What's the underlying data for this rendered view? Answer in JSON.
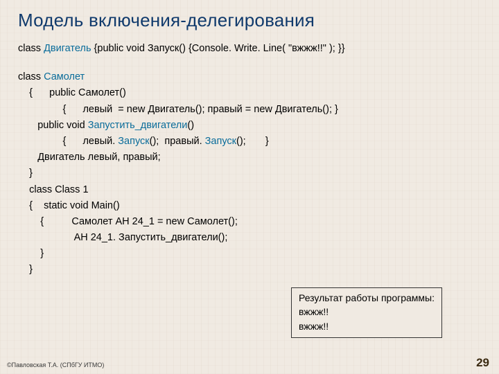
{
  "title": "Модель включения-делегирования",
  "line1": {
    "a": "class ",
    "b": "Двигатель ",
    "c": "{public void Запуск() {Console. Write. Line( \"вжжж!!\" ); }}"
  },
  "code": {
    "l1a": "class ",
    "l1b": "Самолет",
    "l2": "    {      public Самолет()",
    "l3": "                {      левый  = new Двигатель(); правый = new Двигатель(); }",
    "l4a": "       public void ",
    "l4b": "Запустить_двигатели",
    "l4c": "()",
    "l5a": "                {      левый. ",
    "l5b": "Запуск",
    "l5c": "();  правый. ",
    "l5d": "Запуск",
    "l5e": "();       }",
    "l6": "       Двигатель левый, правый;",
    "l7": "    }",
    "l8": "    class Class 1",
    "l9": "    {    static void Main()",
    "l10": "        {          Самолет АН 24_1 = new Самолет();",
    "l11": "                    АН 24_1. Запустить_двигатели();",
    "l12": "        }",
    "l13": "    }"
  },
  "result": {
    "t1": "Результат работы программы:",
    "t2": "вжжж!!",
    "t3": "вжжж!!"
  },
  "footer_left": "©Павловская Т.А. (СПбГУ ИТМО)",
  "page_number": "29"
}
